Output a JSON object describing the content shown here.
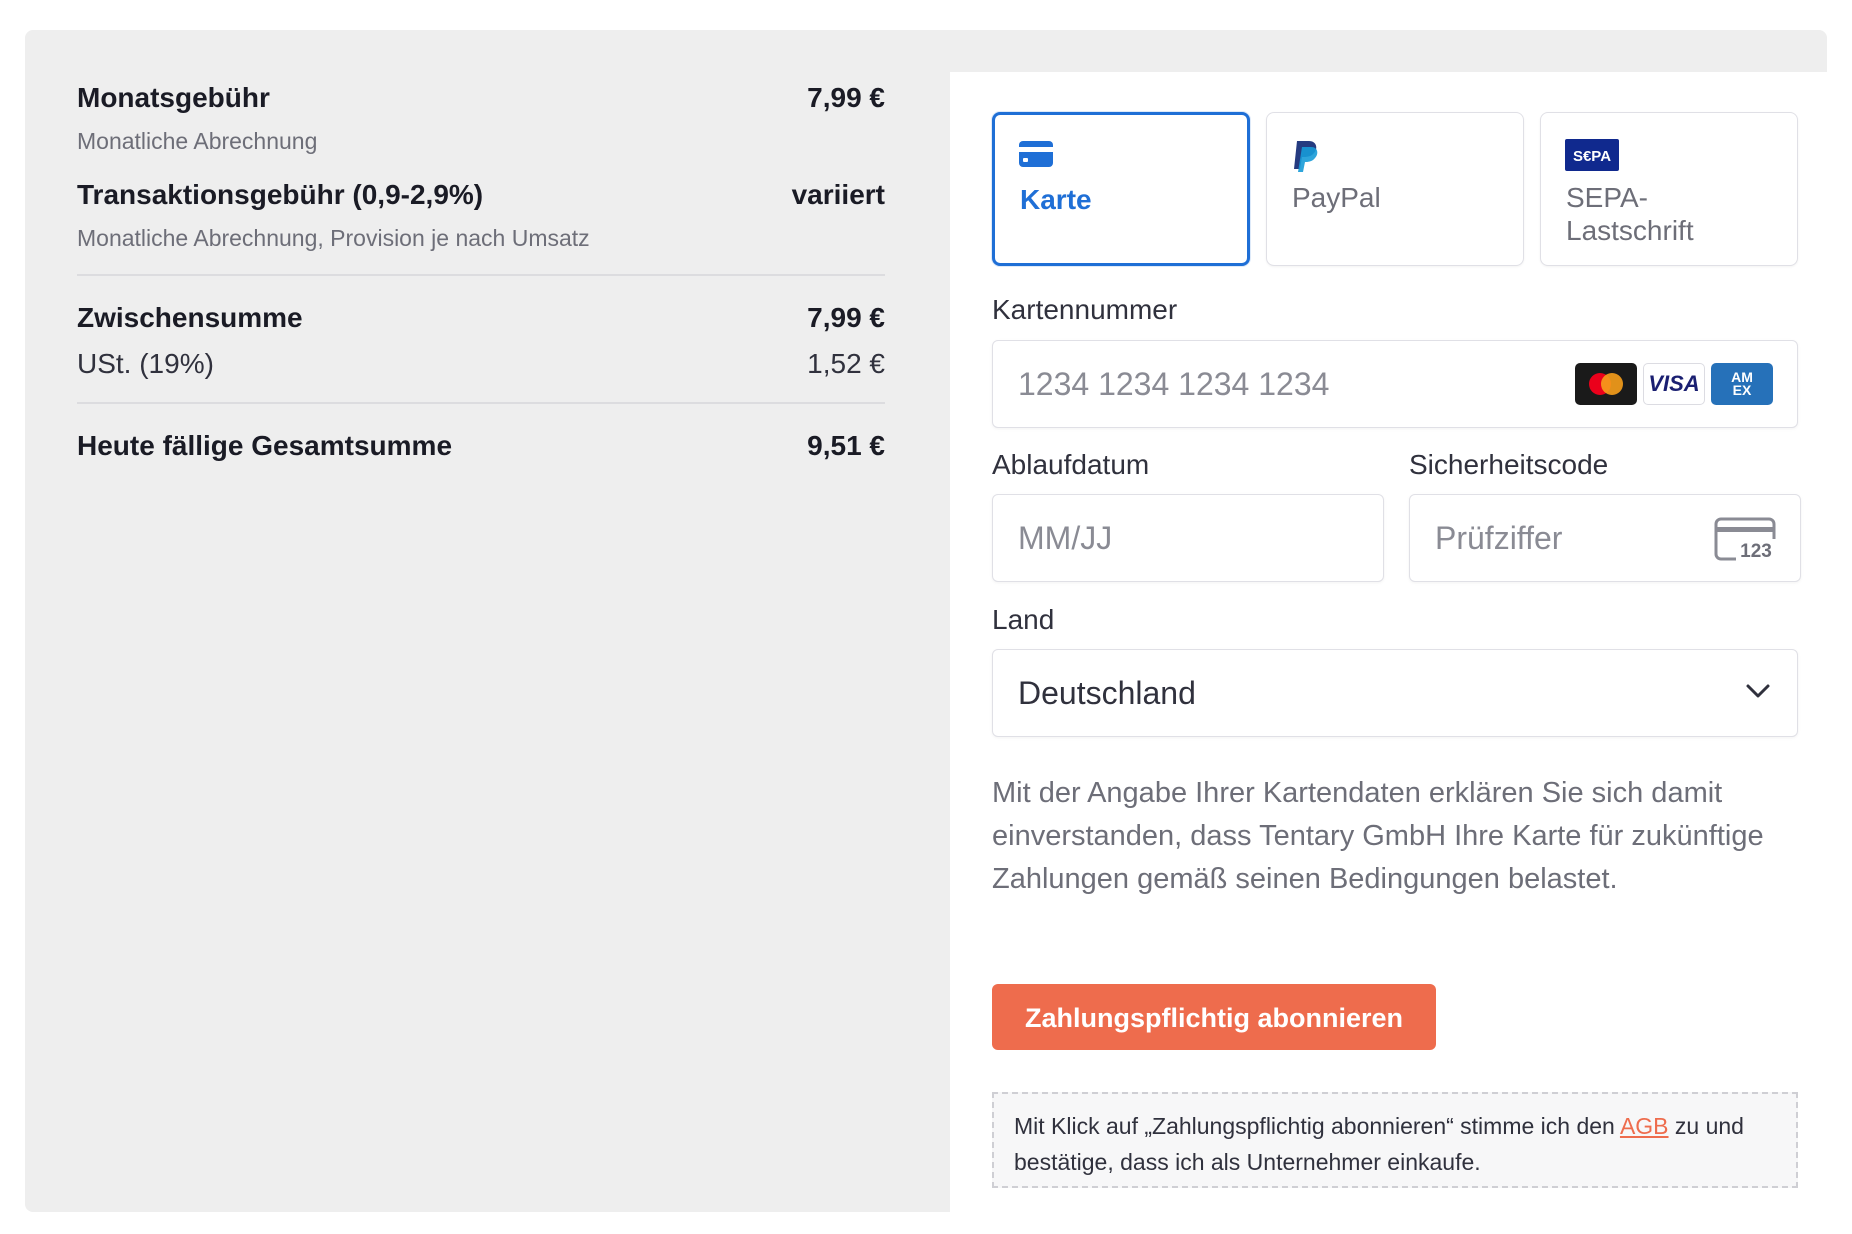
{
  "summary": {
    "monthly_fee": {
      "title": "Monatsgebühr",
      "subtitle": "Monatliche Abrechnung",
      "amount": "7,99 €"
    },
    "transaction_fee": {
      "title": "Transaktionsgebühr (0,9-2,9%)",
      "subtitle": "Monatliche Abrechnung, Provision je nach Umsatz",
      "amount": "variiert"
    },
    "subtotal": {
      "label": "Zwischensumme",
      "amount": "7,99 €"
    },
    "vat": {
      "label": "USt. (19%)",
      "amount": "1,52 €"
    },
    "total": {
      "label": "Heute fällige Gesamtsumme",
      "amount": "9,51 €"
    }
  },
  "payment": {
    "methods": [
      {
        "label": "Karte",
        "icon": "card-icon",
        "selected": true
      },
      {
        "label": "PayPal",
        "icon": "paypal-icon",
        "selected": false
      },
      {
        "label": "SEPA-\nLastschrift",
        "icon": "sepa-icon",
        "selected": false
      }
    ],
    "card_number": {
      "label": "Kartennummer",
      "placeholder": "1234 1234 1234 1234",
      "brands": [
        "mastercard-icon",
        "visa-icon",
        "amex-icon"
      ]
    },
    "expiry": {
      "label": "Ablaufdatum",
      "placeholder": "MM/JJ"
    },
    "cvc": {
      "label": "Sicherheitscode",
      "placeholder": "Prüfziffer",
      "icon_text": "123"
    },
    "country": {
      "label": "Land",
      "value": "Deutschland"
    },
    "legal_text": "Mit der Angabe Ihrer Kartendaten erklären Sie sich damit einverstanden, dass Tentary GmbH Ihre Karte für zukünftige Zahlungen gemäß seinen Bedingungen belastet.",
    "submit_label": "Zahlungspflichtig abonnieren",
    "notice": {
      "before": "Mit Klick auf „Zahlungspflichtig abonnieren“ stimme ich den ",
      "link": "AGB",
      "after": " zu und bestätige, dass ich als Unternehmer einkaufe."
    }
  },
  "brand_labels": {
    "visa": "VISA",
    "amex": "AM EX",
    "sepa": "S€PA"
  },
  "colors": {
    "accent": "#1f6fd6",
    "cta": "#ee6c4d",
    "background": "#eeeeee"
  }
}
